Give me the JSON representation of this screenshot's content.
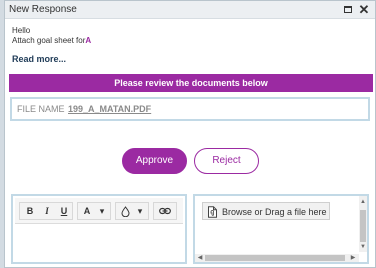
{
  "window": {
    "title": "New Response",
    "maximize_icon": "maximize-icon",
    "close_glyph": "✕"
  },
  "message": {
    "line1": "Hello",
    "line2_prefix": "Attach goal sheet for",
    "line2_accent": "A",
    "read_more": "Read more..."
  },
  "banner": {
    "text": "Please review the documents below"
  },
  "file": {
    "label": "FILE NAME",
    "name": "199_A_MATAN.PDF"
  },
  "actions": {
    "approve": "Approve",
    "reject": "Reject"
  },
  "editor": {
    "toolbar": {
      "bold": "B",
      "italic": "I",
      "underline": "U",
      "font_color": "A",
      "dropdown": "▾"
    }
  },
  "upload": {
    "browse_label": "Browse or Drag a file here"
  },
  "colors": {
    "accent": "#9b2aa2",
    "border": "#c2d9e6",
    "title_bar": "#eceff2"
  }
}
